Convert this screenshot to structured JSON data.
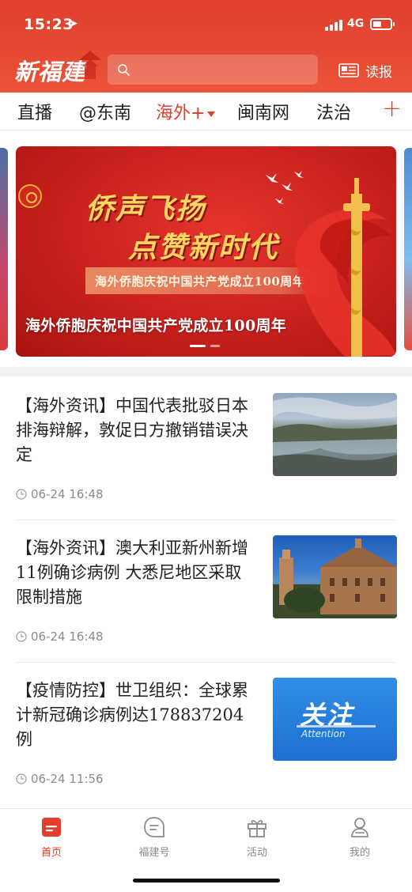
{
  "status_bar": {
    "time": "15:23",
    "network": "4G"
  },
  "header": {
    "logo_text": "新福建",
    "search": {
      "placeholder": ""
    },
    "read_paper_label": "读报"
  },
  "tabs": [
    {
      "label": "直播",
      "active": false
    },
    {
      "label": "@东南",
      "active": false
    },
    {
      "label": "海外+",
      "active": true
    },
    {
      "label": "闽南网",
      "active": false
    },
    {
      "label": "法治",
      "active": false
    }
  ],
  "tab_add_label": "+",
  "carousel": {
    "headline_line1": "侨声飞扬",
    "headline_line2": "点赞新时代",
    "strip_text": "海外侨胞庆祝中国共产党成立100周年",
    "caption": "海外侨胞庆祝中国共产党成立100周年",
    "slide_count": 2,
    "active_slide": 1
  },
  "news": [
    {
      "title": "【海外资讯】中国代表批驳日本排海辩解，敦促日方撤销错误决定",
      "time": "06-24  16:48"
    },
    {
      "title": "【海外资讯】澳大利亚新州新增11例确诊病例 大悉尼地区采取限制措施",
      "time": "06-24  16:48"
    },
    {
      "title": "【疫情防控】世卫组织：全球累计新冠确诊病例达178837204例",
      "time": "06-24  11:56",
      "thumb_text": "关注",
      "thumb_sub": "Attention"
    }
  ],
  "bottom_nav": [
    {
      "label": "首页",
      "icon": "home-icon",
      "active": true
    },
    {
      "label": "福建号",
      "icon": "fujian-hao-icon",
      "active": false
    },
    {
      "label": "活动",
      "icon": "gift-icon",
      "active": false
    },
    {
      "label": "我的",
      "icon": "profile-icon",
      "active": false
    }
  ],
  "colors": {
    "brand_red": "#e33d2b",
    "text_gray": "#8a8a8a"
  }
}
